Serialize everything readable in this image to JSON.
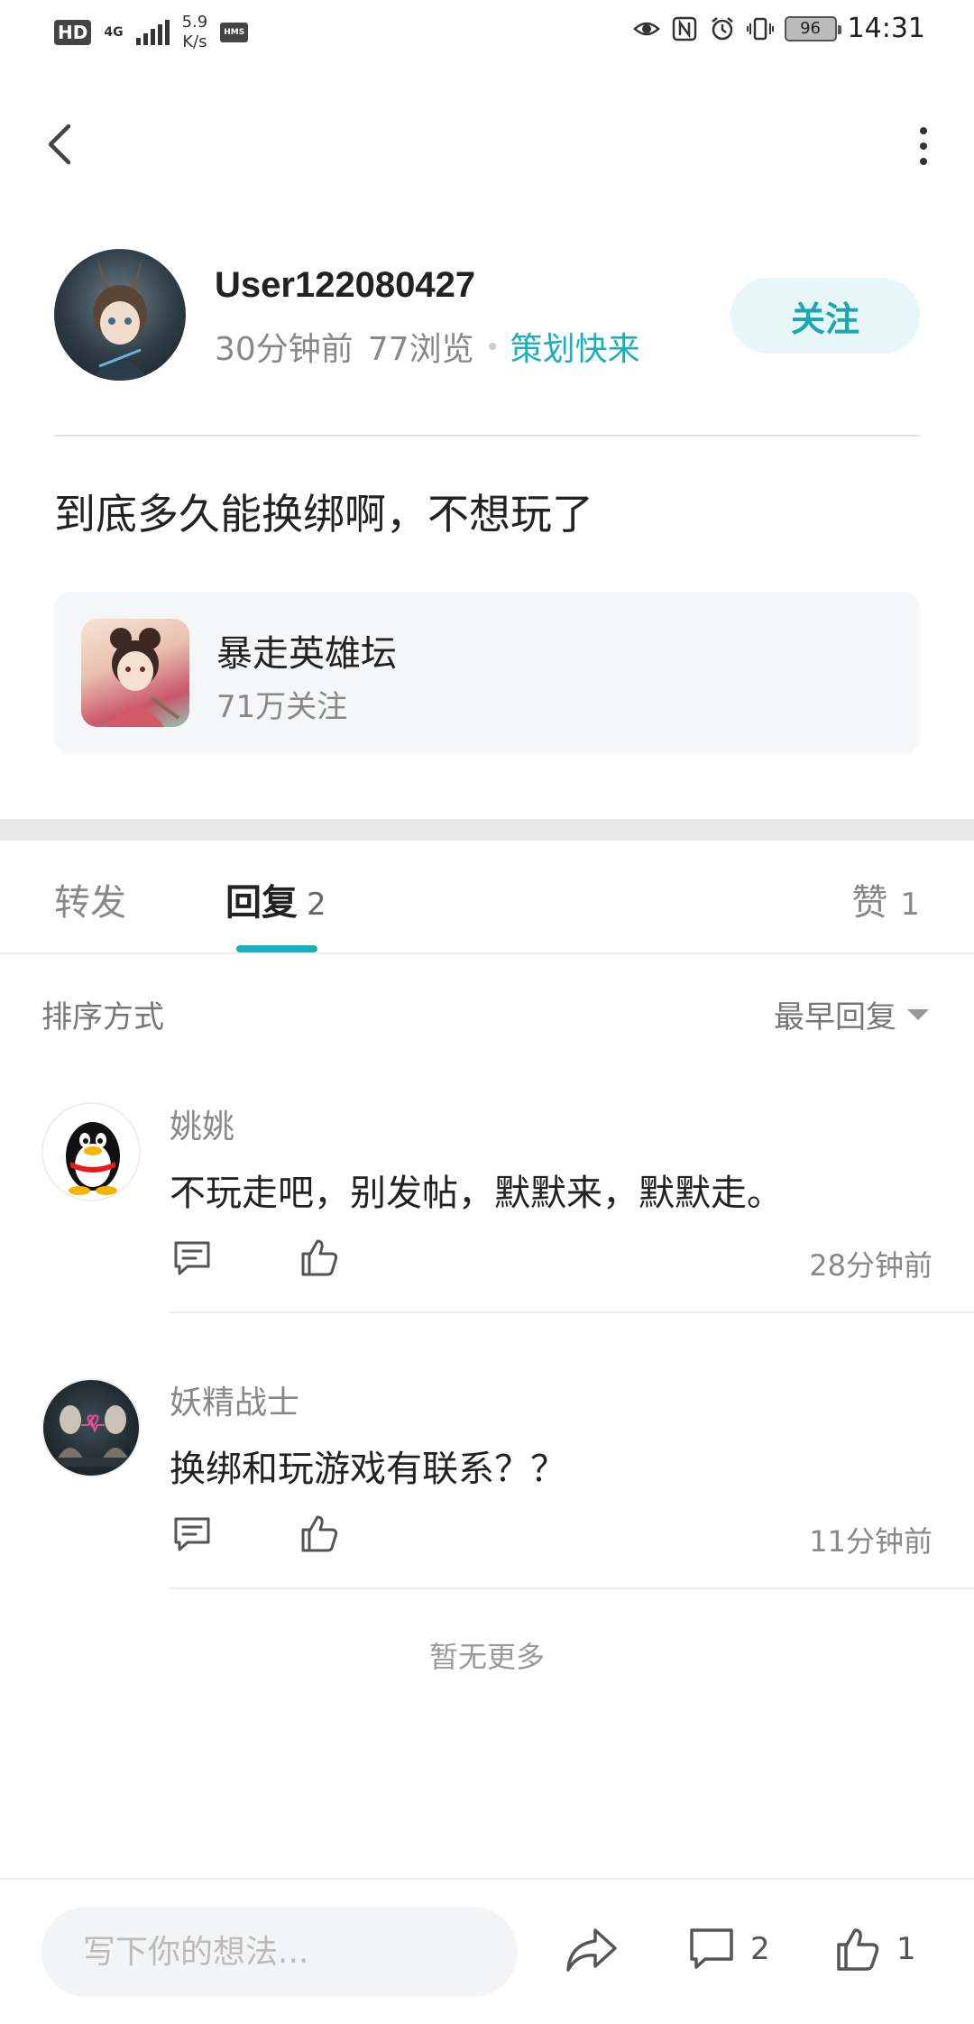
{
  "status_bar": {
    "network": "4G",
    "speed_value": "5.9",
    "speed_unit": "K/s",
    "hd": "HD",
    "hms": "HMS",
    "battery": "96",
    "time": "14:31",
    "icons": [
      "eye-icon",
      "nfc-icon",
      "alarm-icon",
      "vibrate-icon"
    ]
  },
  "author": {
    "name": "User122080427",
    "time_ago": "30分钟前",
    "views": "77浏览",
    "circle": "策划快来",
    "follow_label": "关注"
  },
  "post": {
    "text": "到底多久能换绑啊，不想玩了"
  },
  "forum": {
    "name": "暴走英雄坛",
    "followers": "71万关注"
  },
  "tabs": {
    "forward": "转发",
    "reply": "回复",
    "reply_count": "2",
    "like": "赞",
    "like_count": "1"
  },
  "sort": {
    "label": "排序方式",
    "value": "最早回复"
  },
  "comments": [
    {
      "name": "姚姚",
      "text": "不玩走吧，别发帖，默默来，默默走。",
      "time": "28分钟前"
    },
    {
      "name": "妖精战士",
      "text": "换绑和玩游戏有联系？？",
      "time": "11分钟前"
    }
  ],
  "no_more": "暂无更多",
  "bottom_bar": {
    "input_placeholder": "写下你的想法...",
    "comment_count": "2",
    "like_count": "1"
  },
  "colors": {
    "accent": "#19b0bd",
    "follow_bg": "#e7f6f7",
    "card_bg": "#f5f6f7"
  }
}
